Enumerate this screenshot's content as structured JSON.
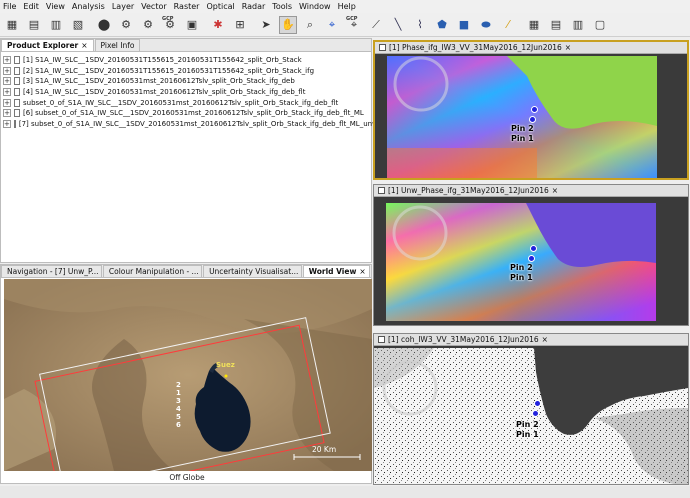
{
  "menu": [
    "File",
    "Edit",
    "View",
    "Analysis",
    "Layer",
    "Vector",
    "Raster",
    "Optical",
    "Radar",
    "Tools",
    "Window",
    "Help"
  ],
  "toolbar": {
    "icons": [
      "new-product-icon",
      "open-product-icon",
      "save-product-icon",
      "close-product-icon",
      "export-icon",
      "graph-builder-icon",
      "batch-processing-icon",
      "gcp-tool-icon",
      "layer-editor-icon",
      "world-map-icon",
      "pin-manager-icon",
      "select-tool-icon",
      "pan-tool-icon",
      "zoom-tool-icon",
      "pin-tool-icon",
      "gcp-placing-tool-icon",
      "range-finder-icon",
      "line-tool-icon",
      "polyline-tool-icon",
      "polygon-tool-icon",
      "rectangle-tool-icon",
      "ellipse-tool-icon",
      "magic-wand-icon",
      "tile-evenly-icon",
      "tile-horizontally-icon",
      "tile-vertically-icon",
      "tile-single-icon"
    ],
    "gcp_label": "GCP"
  },
  "explorer": {
    "tabs": [
      {
        "label": "Product Explorer",
        "close": "×"
      },
      {
        "label": "Pixel Info"
      }
    ],
    "products": [
      "[1] S1A_IW_SLC__1SDV_20160531T155615_20160531T155642_split_Orb_Stack",
      "[2] S1A_IW_SLC__1SDV_20160531T155615_20160531T155642_split_Orb_Stack_ifg",
      "[3] S1A_IW_SLC__1SDV_20160531mst_20160612Tslv_split_Orb_Stack_ifg_deb",
      "[4] S1A_IW_SLC__1SDV_20160531mst_20160612Tslv_split_Orb_Stack_ifg_deb_flt",
      "subset_0_of_S1A_IW_SLC__1SDV_20160531mst_20160612Tslv_split_Orb_Stack_ifg_deb_flt",
      "[6] subset_0_of_S1A_IW_SLC__1SDV_20160531mst_20160612Tslv_split_Orb_Stack_ifg_deb_flt_ML",
      "[7] subset_0_of_S1A_IW_SLC__1SDV_20160531mst_20160612Tslv_split_Orb_Stack_ifg_deb_flt_ML_unwrapped"
    ]
  },
  "nav": {
    "tabs": [
      {
        "label": "Navigation - [7] Unw_P..."
      },
      {
        "label": "Colour Manipulation - ..."
      },
      {
        "label": "Uncertainty Visualisat..."
      },
      {
        "label": "World View",
        "close": "×"
      }
    ],
    "city_label": "Suez",
    "pin_numbers": [
      "2",
      "1",
      "3",
      "4",
      "5",
      "6"
    ],
    "scale_label": "20 Km",
    "status": "Off Globe"
  },
  "windows": [
    {
      "title": "[1] Phase_ifg_IW3_VV_31May2016_12Jun2016",
      "close": "×"
    },
    {
      "title": "[1] Unw_Phase_ifg_31May2016_12Jun2016",
      "close": "×"
    },
    {
      "title": "[1] coh_IW3_VV_31May2016_12Jun2016",
      "close": "×"
    }
  ],
  "pins": {
    "pin2": "Pin 2",
    "pin1": "Pin 1"
  },
  "colors": {
    "land_green": "#8fd44a",
    "water_purple": "#6a4bd6",
    "selection_border": "#c8a020",
    "nav_frame_red": "#ff3b3b",
    "pin_blue": "#2222dd"
  }
}
